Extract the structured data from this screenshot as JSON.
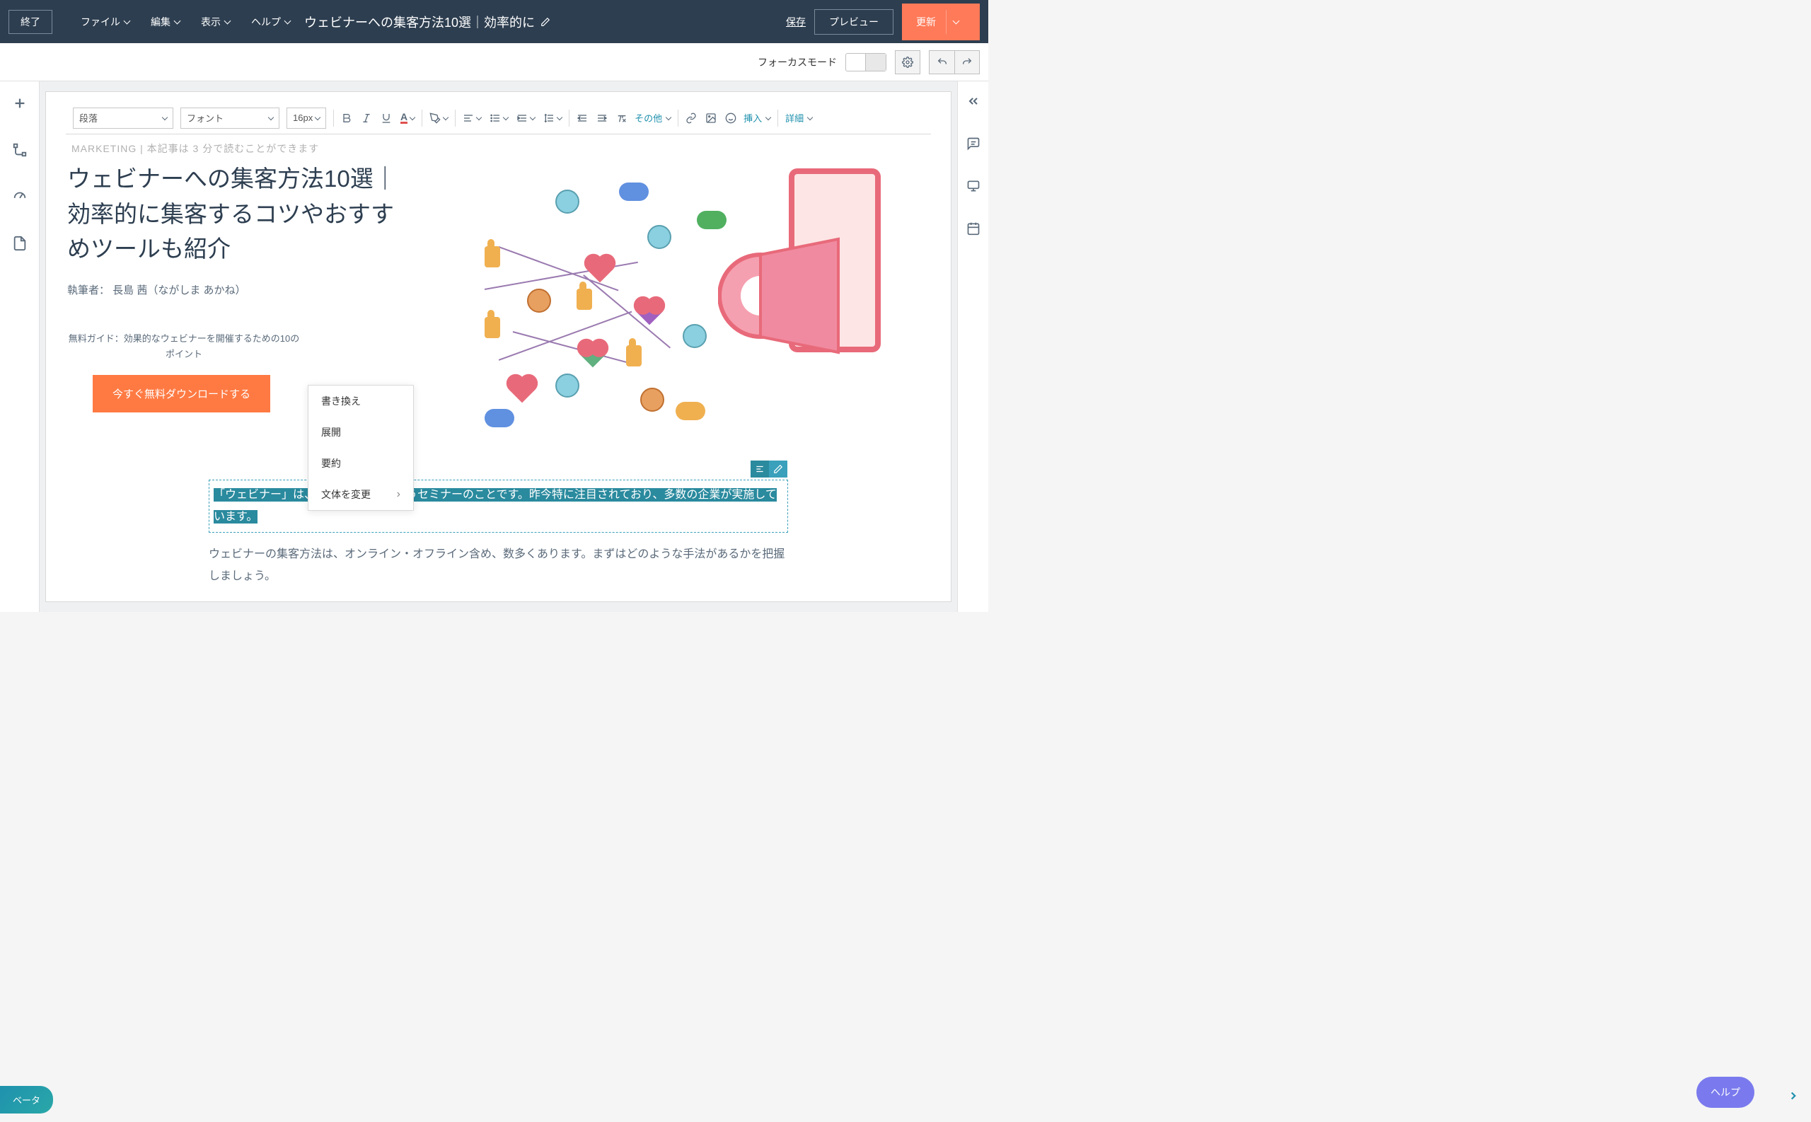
{
  "topbar": {
    "exit": "終了",
    "menus": {
      "file": "ファイル",
      "edit": "編集",
      "view": "表示",
      "help": "ヘルプ"
    },
    "doc_title": "ウェビナーへの集客方法10選｜効率的に",
    "save": "保存",
    "preview": "プレビュー",
    "update": "更新"
  },
  "subbar": {
    "focus_mode": "フォーカスモード"
  },
  "toolbar": {
    "style": "段落",
    "font": "フォント",
    "size": "16px",
    "other": "その他",
    "insert": "挿入",
    "detail": "詳細"
  },
  "article": {
    "marketing_tag": "MARKETING | 本記事は 3 分で読むことができます",
    "title": "ウェビナーへの集客方法10選｜効率的に集客するコツやおすすめツールも紹介",
    "author": "執筆者： 長島 茜（ながしま あかね）",
    "guide": "無料ガイド：効果的なウェビナーを開催するための10のポイント",
    "download": "今すぐ無料ダウンロードする",
    "selected_text": "「ウェビナー」は、オンライン上で行うセミナーのことです。昨今特に注目されており、多数の企業が実施しています。",
    "body_text": "ウェビナーの集客方法は、オンライン・オフライン含め、数多くあります。まずはどのような手法があるかを把握しましょう。"
  },
  "context_menu": {
    "rewrite": "書き換え",
    "expand": "展開",
    "summarize": "要約",
    "change_style": "文体を変更"
  },
  "badges": {
    "beta": "ベータ",
    "help": "ヘルプ"
  }
}
